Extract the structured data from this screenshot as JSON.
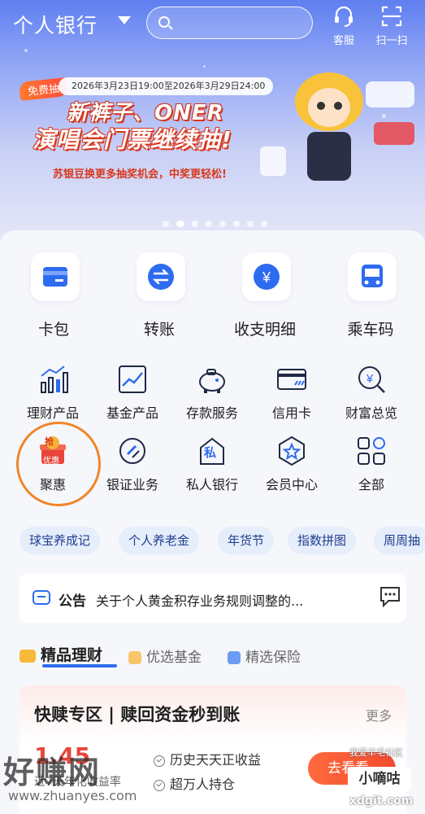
{
  "header": {
    "title": "个人银行",
    "search_placeholder": "",
    "service_label": "客服",
    "scan_label": "扫一扫"
  },
  "banner": {
    "badge": "免费抽",
    "date_range": "2026年3月23日19:00至2026年3月29日24:00",
    "headline_line1": "新裤子、ONER",
    "headline_line2": "演唱会门票继续抽!",
    "subtitle": "苏银豆换更多抽奖机会，中奖更轻松!",
    "slide_count": 8,
    "active_slide": 1
  },
  "quick_actions": [
    {
      "label": "卡包",
      "icon": "card-wallet-icon"
    },
    {
      "label": "转账",
      "icon": "transfer-icon"
    },
    {
      "label": "收支明细",
      "icon": "yuan-detail-icon"
    },
    {
      "label": "乘车码",
      "icon": "bus-icon"
    }
  ],
  "services_row1": [
    {
      "label": "理财产品",
      "icon": "bar-chart-icon"
    },
    {
      "label": "基金产品",
      "icon": "trend-chart-icon"
    },
    {
      "label": "存款服务",
      "icon": "piggy-bank-icon"
    },
    {
      "label": "信用卡",
      "icon": "credit-card-icon"
    },
    {
      "label": "财富总览",
      "icon": "wealth-search-icon"
    }
  ],
  "services_row2": [
    {
      "label": "聚惠",
      "icon": "discount-gift-icon",
      "badge_top": "抢",
      "badge_bottom": "优惠"
    },
    {
      "label": "银证业务",
      "icon": "bank-securities-icon"
    },
    {
      "label": "私人银行",
      "icon": "private-bank-icon",
      "glyph": "私"
    },
    {
      "label": "会员中心",
      "icon": "member-star-icon"
    },
    {
      "label": "全部",
      "icon": "grid-all-icon"
    }
  ],
  "tags": [
    "球宝养成记",
    "个人养老金",
    "年货节",
    "指数拼图",
    "周周抽"
  ],
  "notice": {
    "tag": "公告",
    "text": "关于个人黄金积存业务规则调整的..."
  },
  "wealth_tabs": [
    {
      "label": "精品理财",
      "active": true
    },
    {
      "label": "优选基金",
      "active": false
    },
    {
      "label": "精选保险",
      "active": false
    }
  ],
  "product": {
    "title": "快赎专区 | 赎回资金秒到账",
    "more": "更多",
    "yield": "1.45",
    "yield_label": "近7天年化收益率",
    "features": [
      "历史天天正收益",
      "超万人持仓"
    ],
    "button": "去看看"
  },
  "watermarks": {
    "left": "好赚网",
    "left_url": "www.zhuanyes.com",
    "right_tag": "小嘀咕",
    "right_url": "xdgit.com",
    "right_top": "我爱羊毛社区"
  },
  "colors": {
    "header_blue": "#5f7ff0",
    "accent_blue": "#2d6bf0",
    "promo_red": "#e8463a",
    "annotation_orange": "#f0862a"
  }
}
